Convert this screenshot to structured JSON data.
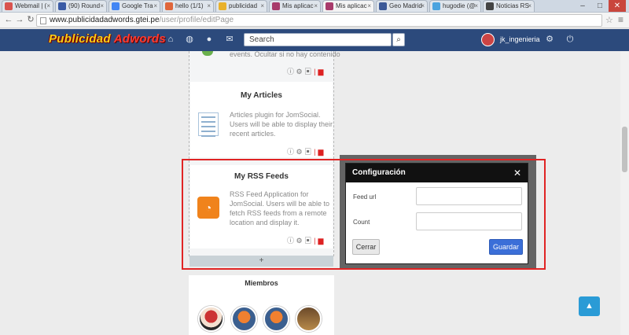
{
  "browser": {
    "tabs": [
      {
        "label": "Webmail | (",
        "fav": "#d9534f"
      },
      {
        "label": "(90) Round",
        "fav": "#3b5ba5"
      },
      {
        "label": "Google Tra",
        "fav": "#4285f4"
      },
      {
        "label": "hello (1/1)",
        "fav": "#e0663b"
      },
      {
        "label": "publicidad",
        "fav": "#e9b12b"
      },
      {
        "label": "Mis aplicac",
        "fav": "#a83b6b"
      },
      {
        "label": "Mis aplicac",
        "fav": "#a83b6b",
        "active": true
      },
      {
        "label": "Geo Madrid",
        "fav": "#3b5998"
      },
      {
        "label": "hugodie (@",
        "fav": "#4aa3df"
      },
      {
        "label": "Noticias RS",
        "fav": "#444444"
      }
    ],
    "url_host": "www.publicidadadwords.gtei.pe",
    "url_path": "/user/profile/editPage"
  },
  "header": {
    "logo_part1": "Publicidad",
    "logo_part2": "Adwords",
    "search_placeholder": "Search",
    "username": "jk_ingenieria"
  },
  "events_fragment": "events. Ocultar si no hay contenido",
  "articles": {
    "title": "My Articles",
    "desc": [
      "Articles plugin for JomSocial.",
      "Users will be able to display their",
      "recent articles."
    ]
  },
  "rss": {
    "title": "My RSS Feeds",
    "desc": [
      "RSS Feed Application for",
      "JomSocial. Users will be able to",
      "fetch RSS feeds from a remote",
      "location and display it."
    ]
  },
  "add_label": "+",
  "modal": {
    "title": "Configuración",
    "close": "✕",
    "feed_url_label": "Feed url",
    "count_label": "Count",
    "cancel": "Cerrar",
    "save": "Guardar"
  },
  "members": {
    "title": "Miembros"
  },
  "icons": {
    "info": "ℹ",
    "settings": "⚙",
    "lock": "🔒",
    "trash": "🗑",
    "up": "▲"
  }
}
